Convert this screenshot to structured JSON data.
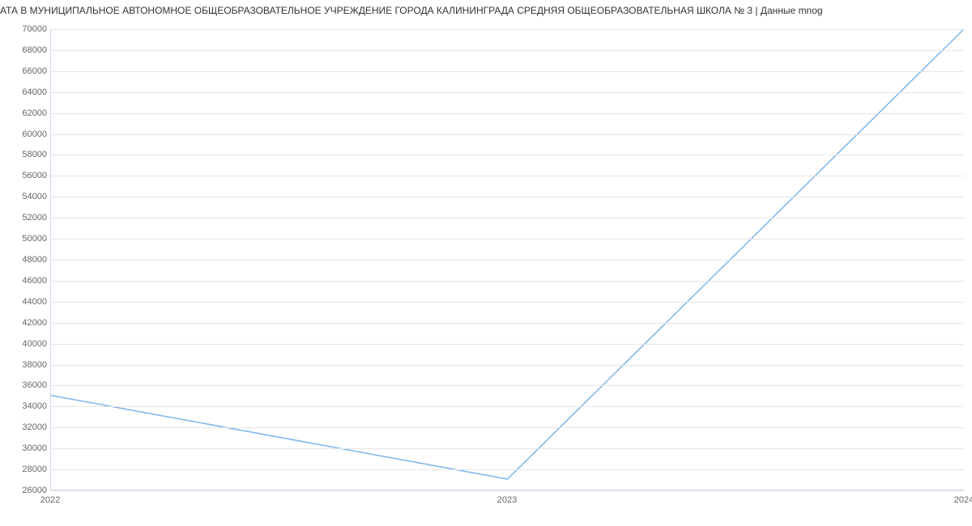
{
  "title": "АТА В МУНИЦИПАЛЬНОЕ АВТОНОМНОЕ ОБЩЕОБРАЗОВАТЕЛЬНОЕ УЧРЕЖДЕНИЕ ГОРОДА КАЛИНИНГРАДА СРЕДНЯЯ ОБЩЕОБРАЗОВАТЕЛЬНАЯ ШКОЛА № 3 | Данные mnog",
  "chart_data": {
    "type": "line",
    "categories": [
      "2022",
      "2023",
      "2024"
    ],
    "values": [
      35000,
      27000,
      70000
    ],
    "title": "АТА В МУНИЦИПАЛЬНОЕ АВТОНОМНОЕ ОБЩЕОБРАЗОВАТЕЛЬНОЕ УЧРЕЖДЕНИЕ ГОРОДА КАЛИНИНГРАДА СРЕДНЯЯ ОБЩЕОБРАЗОВАТЕЛЬНАЯ ШКОЛА № 3 | Данные mnog",
    "xlabel": "",
    "ylabel": "",
    "ylim": [
      26000,
      70000
    ],
    "y_ticks": [
      26000,
      28000,
      30000,
      32000,
      34000,
      36000,
      38000,
      40000,
      42000,
      44000,
      46000,
      48000,
      50000,
      52000,
      54000,
      56000,
      58000,
      60000,
      62000,
      64000,
      66000,
      68000,
      70000
    ],
    "line_color": "#7cb5ec"
  }
}
